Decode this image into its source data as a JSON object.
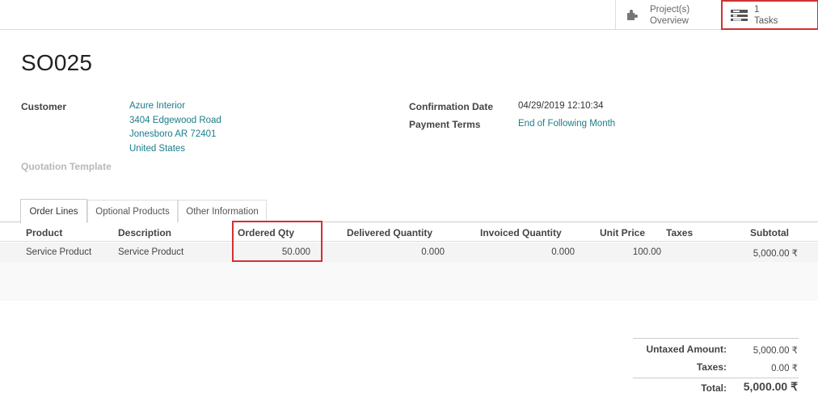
{
  "smart_buttons": {
    "projects": {
      "line1": "Project(s)",
      "line2": "Overview",
      "icon": "puzzle-icon"
    },
    "tasks": {
      "count": "1",
      "label": "Tasks",
      "icon": "tasks-icon"
    }
  },
  "order": {
    "name": "SO025",
    "customer_label": "Customer",
    "customer": {
      "name": "Azure Interior",
      "street": "3404 Edgewood Road",
      "city": "Jonesboro AR 72401",
      "country": "United States"
    },
    "quotation_template_label": "Quotation Template",
    "confirmation_date_label": "Confirmation Date",
    "confirmation_date": "04/29/2019 12:10:34",
    "payment_terms_label": "Payment Terms",
    "payment_terms": "End of Following Month"
  },
  "tabs": [
    {
      "label": "Order Lines",
      "active": true
    },
    {
      "label": "Optional Products",
      "active": false
    },
    {
      "label": "Other Information",
      "active": false
    }
  ],
  "table": {
    "columns": [
      "Product",
      "Description",
      "Ordered Qty",
      "Delivered Quantity",
      "Invoiced Quantity",
      "Unit Price",
      "Taxes",
      "Subtotal"
    ],
    "rows": [
      {
        "product": "Service Product",
        "description": "Service Product",
        "ordered_qty": "50.000",
        "delivered_qty": "0.000",
        "invoiced_qty": "0.000",
        "unit_price": "100.00",
        "taxes": "",
        "subtotal": "5,000.00 ₹"
      }
    ]
  },
  "totals": {
    "untaxed_label": "Untaxed Amount:",
    "untaxed_value": "5,000.00 ₹",
    "taxes_label": "Taxes:",
    "taxes_value": "0.00 ₹",
    "total_label": "Total:",
    "total_value": "5,000.00 ₹"
  },
  "colors": {
    "link": "#1b7d8a",
    "highlight": "#d33030"
  }
}
